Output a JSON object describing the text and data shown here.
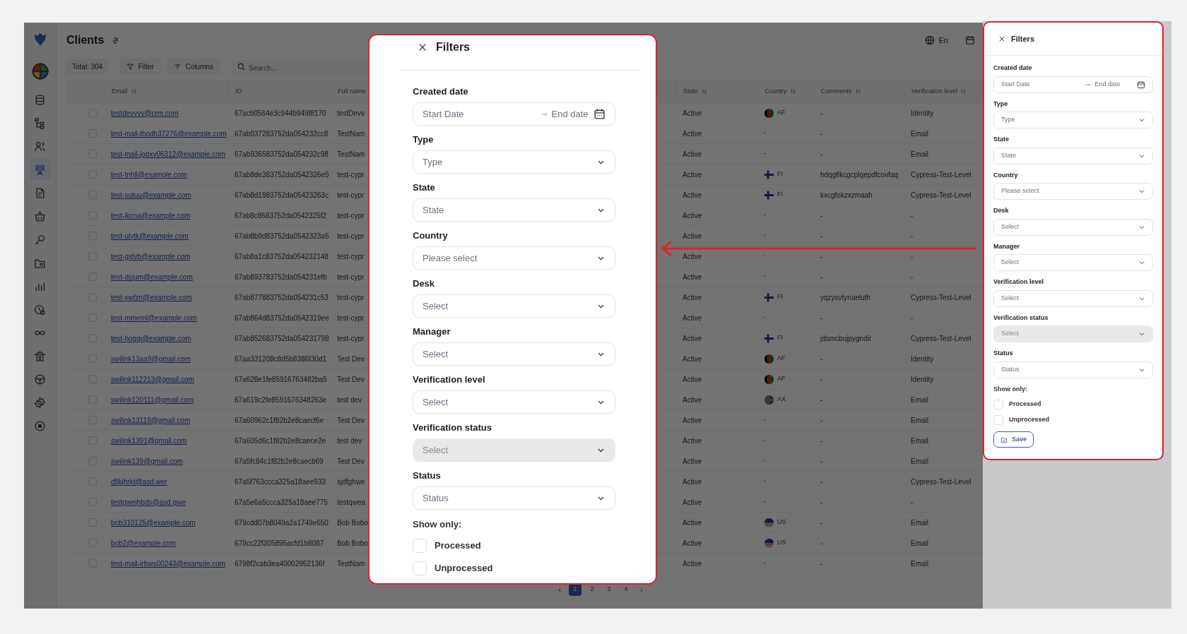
{
  "app": {
    "title": "Clients",
    "toolbar": {
      "total": "Total: 304",
      "filter": "Filter",
      "columns": "Columns",
      "search_placeholder": "Search..."
    },
    "language": "En",
    "sidebar": {
      "items": [
        {
          "kind": "pie",
          "selected": false
        },
        {
          "kind": "database",
          "selected": false
        },
        {
          "kind": "hierarchy",
          "selected": false
        },
        {
          "kind": "users",
          "selected": false
        },
        {
          "kind": "group",
          "selected": true
        },
        {
          "kind": "document",
          "selected": false
        },
        {
          "kind": "basket",
          "selected": false
        },
        {
          "kind": "key",
          "selected": false
        },
        {
          "kind": "folder",
          "selected": false
        },
        {
          "kind": "bars",
          "selected": false
        },
        {
          "kind": "clock",
          "selected": false
        },
        {
          "kind": "infinity",
          "selected": false
        },
        {
          "kind": "bank",
          "selected": false
        },
        {
          "kind": "wheel",
          "selected": false
        },
        {
          "kind": "gear",
          "selected": false
        },
        {
          "kind": "target",
          "selected": false
        }
      ]
    },
    "table": {
      "columns": [
        {
          "label": "Email",
          "sortable": true
        },
        {
          "label": "ID",
          "sortable": false
        },
        {
          "label": "Full name"
        },
        {
          "label": "State",
          "sortable": true
        },
        {
          "label": "Country",
          "sortable": true
        },
        {
          "label": "Comments",
          "sortable": true
        },
        {
          "label": "Verification level",
          "sortable": true
        }
      ],
      "rows": [
        {
          "checked": false,
          "email": "testdevvvv@crm.com",
          "id": "67acb0564e3c944b949f8170",
          "full_name": "testDevv",
          "state": "Active",
          "country": {
            "kind": "af",
            "code": "AF"
          },
          "comments": "-",
          "verification_level": "Identity"
        },
        {
          "checked": false,
          "email": "test-mail-thodh37276@example.com",
          "id": "67ab937283752da054232cc8",
          "full_name": "TestNam",
          "state": "Active",
          "country": "-",
          "comments": "-",
          "verification_level": "Email"
        },
        {
          "checked": false,
          "email": "test-mail-jopxv06312@example.com",
          "id": "67ab936583752da054232c98",
          "full_name": "TestNam",
          "state": "Active",
          "country": "-",
          "comments": "-",
          "verification_level": "Email"
        },
        {
          "checked": false,
          "email": "test-tnhll@example.com",
          "id": "67ab8de383752da0542326e5",
          "full_name": "test-cypr",
          "state": "Active",
          "country": {
            "kind": "fi",
            "code": "FI"
          },
          "comments": "hdqgflkcgcplqepdfcovfaq",
          "verification_level": "Cypress-Test-Level"
        },
        {
          "checked": false,
          "email": "test-sutuu@example.com",
          "id": "67ab8d1983752da05423263c",
          "full_name": "test-cypr",
          "state": "Active",
          "country": {
            "kind": "fi",
            "code": "FI"
          },
          "comments": "kxcgfokzxzmaah",
          "verification_level": "Cypress-Test-Level"
        },
        {
          "checked": false,
          "email": "test-jkcna@example.com",
          "id": "67ab8c8683752da0542325f2",
          "full_name": "test-cypr",
          "state": "Active",
          "country": "-",
          "comments": "-",
          "verification_level": "-"
        },
        {
          "checked": false,
          "email": "test-ulytk@example.com",
          "id": "67ab8b9d83752da0542323a5",
          "full_name": "test-cypr",
          "state": "Active",
          "country": "-",
          "comments": "-",
          "verification_level": "-"
        },
        {
          "checked": false,
          "email": "test-gxlvb@example.com",
          "id": "67ab8a1c83752da054232148",
          "full_name": "test-cypr",
          "state": "Active",
          "country": "-",
          "comments": "-",
          "verification_level": "-"
        },
        {
          "checked": false,
          "email": "test-dsjum@example.com",
          "id": "67ab893783752da054231efb",
          "full_name": "test-cypr",
          "state": "Active",
          "country": "-",
          "comments": "-",
          "verification_level": "-"
        },
        {
          "checked": false,
          "email": "test-ywfzn@example.com",
          "id": "67ab877883752da054231c53",
          "full_name": "test-cypr",
          "state": "Active",
          "country": {
            "kind": "fi",
            "code": "FI"
          },
          "comments": "yqzysvtynaeluth",
          "verification_level": "Cypress-Test-Level"
        },
        {
          "checked": false,
          "email": "test-mmeml@example.com",
          "id": "67ab864d83752da0542319ee",
          "full_name": "test-cypr",
          "state": "Active",
          "country": "-",
          "comments": "-",
          "verification_level": "-"
        },
        {
          "checked": false,
          "email": "test-hoqqi@example.com",
          "id": "67ab852683752da054231798",
          "full_name": "test-cypr",
          "state": "Active",
          "country": {
            "kind": "fi",
            "code": "FI"
          },
          "comments": "jdsmcbujpygndir",
          "verification_level": "Cypress-Test-Level"
        },
        {
          "checked": false,
          "email": "swilink13aa9@gmail.com",
          "id": "67aa331208c8d5b8386f30d1",
          "full_name": "Test Dev",
          "state": "Active",
          "country": {
            "kind": "af",
            "code": "AF"
          },
          "comments": "-",
          "verification_level": "Identity"
        },
        {
          "checked": false,
          "email": "swilink112213@gmail.com",
          "id": "67a628e1fe85916763482ba5",
          "full_name": "Test Dev",
          "state": "Active",
          "country": {
            "kind": "af",
            "code": "AF"
          },
          "comments": "-",
          "verification_level": "Identity"
        },
        {
          "checked": false,
          "email": "swilink120111@gmail.com",
          "id": "67a619c2fe8591676348263e",
          "full_name": "test dev",
          "state": "Active",
          "country": {
            "kind": "ax",
            "code": "AX"
          },
          "comments": "-",
          "verification_level": "Email"
        },
        {
          "checked": false,
          "email": "swilink13119@gmail.com",
          "id": "67a60962c1f82b2e8caecf6e",
          "full_name": "Test Dev",
          "state": "Active",
          "country": "-",
          "comments": "-",
          "verification_level": "Email"
        },
        {
          "checked": false,
          "email": "swilink1391@gmail.com",
          "id": "67a605d6c1f82b2e8caece2e",
          "full_name": "test dev",
          "state": "Active",
          "country": "-",
          "comments": "-",
          "verification_level": "Email"
        },
        {
          "checked": false,
          "email": "swilink139@gmail.com",
          "id": "67a5fc84c1f82b2e8caecb69",
          "full_name": "Test Dev",
          "state": "Active",
          "country": "-",
          "comments": "-",
          "verification_level": "Email"
        },
        {
          "checked": false,
          "email": "dfjkjhrkt@asd.wer",
          "id": "67a5f763ccca325a18aee933",
          "full_name": "sjdfghwe",
          "state": "Active",
          "country": "-",
          "comments": "-",
          "verification_level": "Cypress-Test-Level"
        },
        {
          "checked": false,
          "email": "testqwejhbds@asd.qwe",
          "id": "67a5e6a5ccca325a18aee775",
          "full_name": "testqwea",
          "state": "Active",
          "country": "-",
          "comments": "-",
          "verification_level": "-"
        },
        {
          "checked": false,
          "email": "bob310125@example.com",
          "id": "679cdd07b8049a2a1749e650",
          "full_name": "Bob Bobo",
          "state": "Active",
          "country": {
            "kind": "us",
            "code": "US"
          },
          "comments": "-",
          "verification_level": "Email"
        },
        {
          "checked": false,
          "email": "bob2@example.com",
          "id": "679cc22f305895acfd1b8087",
          "full_name": "Bob Bobo",
          "state": "Active",
          "country": {
            "kind": "us",
            "code": "US"
          },
          "comments": "-",
          "verification_level": "Email"
        },
        {
          "checked": false,
          "email": "test-mail-irbws00243@example.com",
          "id": "6798f2cab3ea40002952136f",
          "full_name": "TestNam",
          "state": "Active",
          "country": "-",
          "comments": "-",
          "verification_level": "Email"
        }
      ]
    },
    "pagination": {
      "prev": "‹",
      "next": "›",
      "pages": [
        {
          "label": "1",
          "selected": true
        },
        {
          "label": "2",
          "selected": false
        },
        {
          "label": "3",
          "selected": false
        },
        {
          "label": "4",
          "selected": false
        }
      ]
    }
  },
  "filter_modal": {
    "title": "Filters",
    "date": {
      "label": "Created date",
      "start": "Start Date",
      "end": "End date"
    },
    "selects": [
      {
        "label": "Type",
        "placeholder": "Type",
        "disabled": false
      },
      {
        "label": "State",
        "placeholder": "State",
        "disabled": false
      },
      {
        "label": "Country",
        "placeholder": "Please select",
        "disabled": false
      },
      {
        "label": "Desk",
        "placeholder": "Select",
        "disabled": false
      },
      {
        "label": "Manager",
        "placeholder": "Select",
        "disabled": false
      },
      {
        "label": "Verification level",
        "placeholder": "Select",
        "disabled": false
      },
      {
        "label": "Verification status",
        "placeholder": "Select",
        "disabled": true
      },
      {
        "label": "Status",
        "placeholder": "Status",
        "disabled": false
      }
    ],
    "show_only": "Show only:",
    "checkboxes": [
      {
        "label": "Processed",
        "checked": false
      },
      {
        "label": "Unprocessed",
        "checked": false
      }
    ]
  },
  "filter_drawer": {
    "title": "Filters",
    "date": {
      "label": "Created date",
      "start": "Start Date",
      "end": "End date"
    },
    "selects": [
      {
        "label": "Type",
        "placeholder": "Type",
        "disabled": false
      },
      {
        "label": "State",
        "placeholder": "State",
        "disabled": false
      },
      {
        "label": "Country",
        "placeholder": "Please select",
        "disabled": false
      },
      {
        "label": "Desk",
        "placeholder": "Select",
        "disabled": false
      },
      {
        "label": "Manager",
        "placeholder": "Select",
        "disabled": false
      },
      {
        "label": "Verification level",
        "placeholder": "Select",
        "disabled": false
      },
      {
        "label": "Verification status",
        "placeholder": "Select",
        "disabled": true
      },
      {
        "label": "Status",
        "placeholder": "Status",
        "disabled": false
      }
    ],
    "show_only": "Show only:",
    "checkboxes": [
      {
        "label": "Processed",
        "checked": false
      },
      {
        "label": "Unprocessed",
        "checked": false
      }
    ],
    "save": "Save"
  }
}
